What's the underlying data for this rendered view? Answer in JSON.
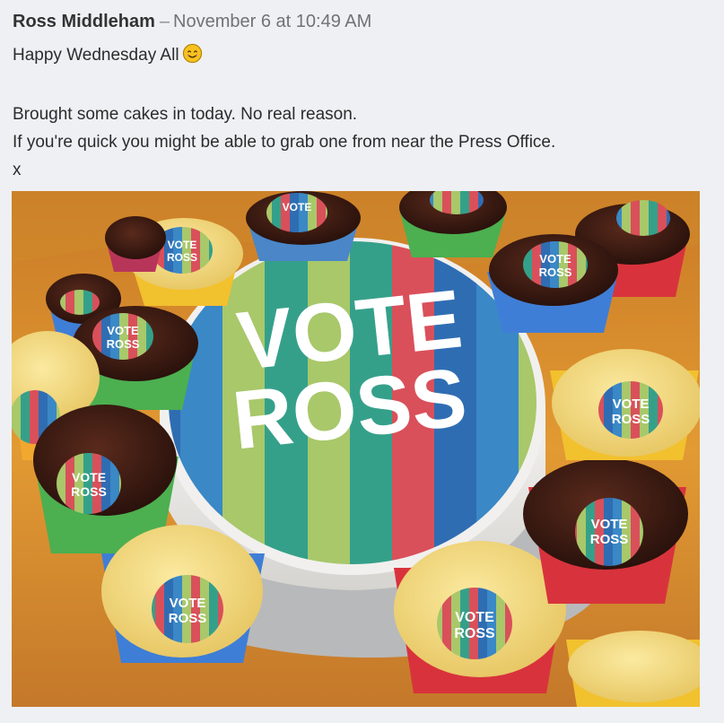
{
  "post": {
    "author": "Ross Middleham",
    "separator": "–",
    "timestamp": "November 6 at 10:49 AM",
    "lines": [
      "Happy Wednesday All",
      "",
      "Brought some cakes in today. No real reason.",
      "If you're quick you might be able to grab one from near the Press Office.",
      "x"
    ],
    "emoji": "smiling-face-icon"
  },
  "photo": {
    "cake_text_line1": "VOTE",
    "cake_text_line2": "ROSS",
    "cupcake_text_line1": "VOTE",
    "cupcake_text_line2": "ROSS"
  },
  "colors": {
    "background": "#eef0f3",
    "table_orange": "#d98a2a",
    "stripe_red": "#d9505a",
    "stripe_blue": "#2f6db3",
    "stripe_green": "#35a08a",
    "stripe_lime": "#a8c86a",
    "fondant": "#f1f0ee",
    "chocolate": "#3b1a12",
    "cheesecake": "#f3dc86"
  }
}
